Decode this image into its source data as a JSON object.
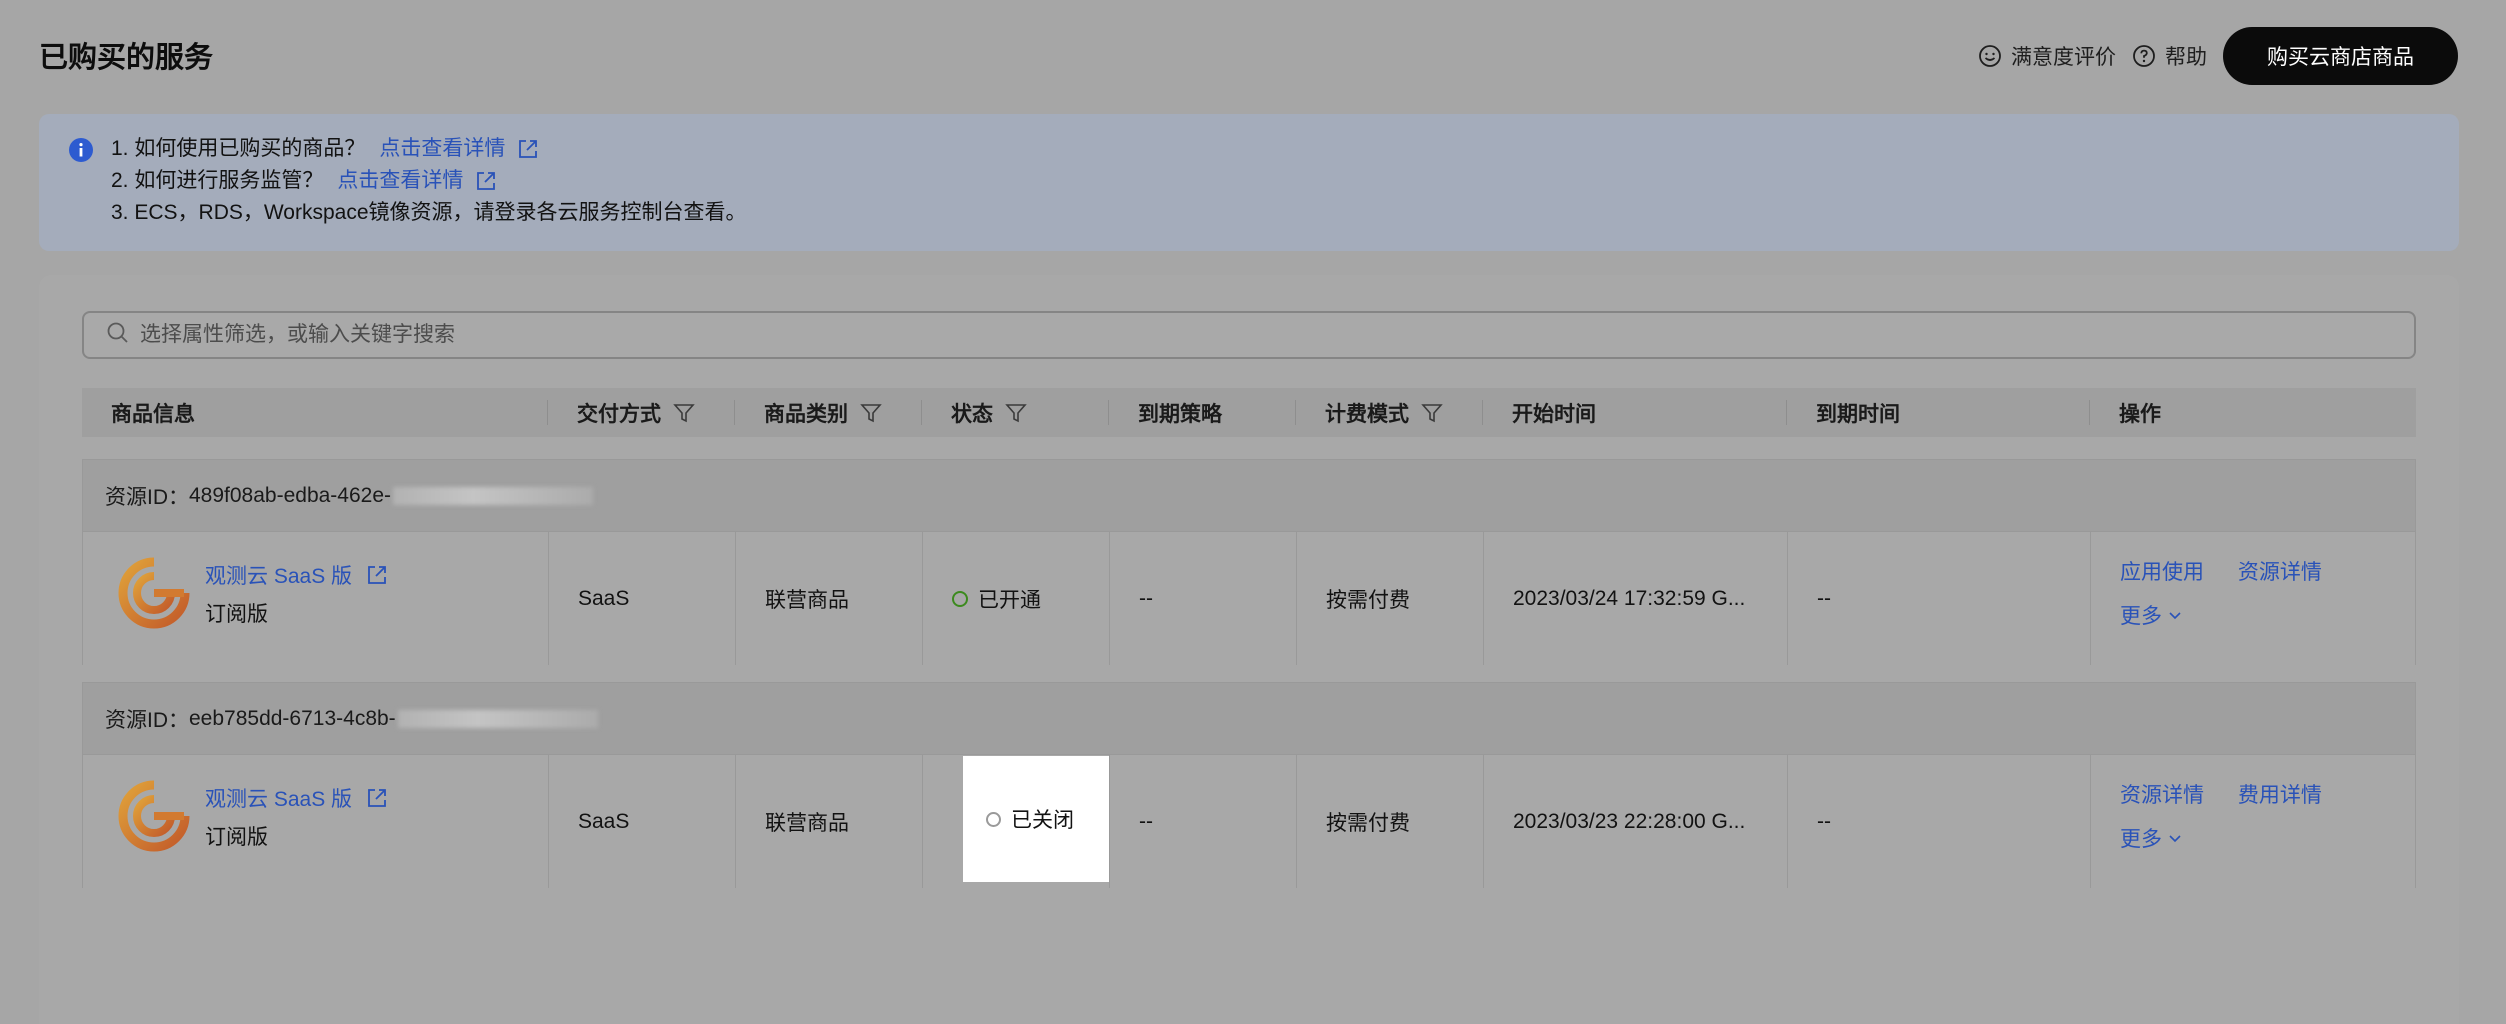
{
  "header": {
    "title": "已购买的服务",
    "satisfaction_label": "满意度评价",
    "help_label": "帮助",
    "buy_button_label": "购买云商店商品"
  },
  "notice": {
    "line1_text": "1. 如何使用已购买的商品？",
    "line1_link": "点击查看详情",
    "line2_text": "2. 如何进行服务监管？",
    "line2_link": "点击查看详情",
    "line3_text": "3. ECS，RDS，Workspace镜像资源，请登录各云服务控制台查看。"
  },
  "search": {
    "placeholder": "选择属性筛选，或输入关键字搜索"
  },
  "table": {
    "columns": [
      "商品信息",
      "交付方式",
      "商品类别",
      "状态",
      "到期策略",
      "计费模式",
      "开始时间",
      "到期时间",
      "操作"
    ],
    "rows": [
      {
        "resource_label": "资源ID：",
        "resource_id": "489f08ab-edba-462e-",
        "product_name": "观测云 SaaS 版",
        "product_edition": "订阅版",
        "delivery": "SaaS",
        "category": "联营商品",
        "status": "已开通",
        "status_color": "#3c8a1e",
        "expiry_policy": "--",
        "billing": "按需付费",
        "start_time": "2023/03/24 17:32:59 G...",
        "end_time": "--",
        "op1": "应用使用",
        "op2": "资源详情",
        "more": "更多"
      },
      {
        "resource_label": "资源ID：",
        "resource_id": "eeb785dd-6713-4c8b-",
        "product_name": "观测云 SaaS 版",
        "product_edition": "订阅版",
        "delivery": "SaaS",
        "category": "联营商品",
        "status": "已关闭",
        "status_color": "#9a9a9a",
        "expiry_policy": "--",
        "billing": "按需付费",
        "start_time": "2023/03/23 22:28:00 G...",
        "end_time": "--",
        "op1": "资源详情",
        "op2": "费用详情",
        "more": "更多"
      }
    ]
  },
  "colors": {
    "link": "#2952b8",
    "buy_button_bg": "#0b0b0b",
    "notice_bg": "#a4acbb"
  }
}
